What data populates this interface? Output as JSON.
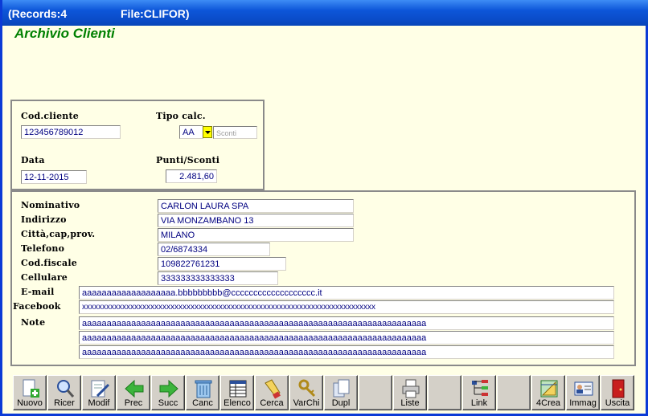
{
  "titlebar": {
    "records": "(Records:4",
    "file": "File:CLIFOR)"
  },
  "app_title": "Archivio Clienti",
  "top_panel": {
    "cod_cliente_label": "Cod.cliente",
    "cod_cliente_value": "123456789012",
    "tipo_calc_label": "Tipo calc.",
    "tipo_calc_value": "AA",
    "sconti_placeholder": "Sconti",
    "data_label": "Data",
    "data_value": "12-11-2015",
    "punti_label": "Punti/Sconti",
    "punti_value": "2.481,60"
  },
  "main_panel": {
    "nominativo_label": "Nominativo",
    "nominativo_value": "CARLON LAURA SPA",
    "indirizzo_label": "Indirizzo",
    "indirizzo_value": "VIA MONZAMBANO 13",
    "citta_label": "Città,cap,prov.",
    "citta_value": "MILANO",
    "telefono_label": "Telefono",
    "telefono_value": "02/6874334",
    "codfiscale_label": "Cod.fiscale",
    "codfiscale_value": "109822761231",
    "cellulare_label": "Cellulare",
    "cellulare_value": "333333333333333",
    "email_label": "E-mail",
    "email_value": "aaaaaaaaaaaaaaaaaaa.bbbbbbbbb@ccccccccccccccccccc.it",
    "facebook_label": "Facebook",
    "facebook_value": "xxxxxxxxxxxxxxxxxxxxxxxxxxxxxxxxxxxxxxxxxxxxxxxxxxxxxxxxxxxxxxxxxxxxxxxxx",
    "note_label": "Note",
    "note_lines": [
      "aaaaaaaaaaaaaaaaaaaaaaaaaaaaaaaaaaaaaaaaaaaaaaaaaaaaaaaaaaaaaaaaaaaaaa",
      "aaaaaaaaaaaaaaaaaaaaaaaaaaaaaaaaaaaaaaaaaaaaaaaaaaaaaaaaaaaaaaaaaaaaaa",
      "aaaaaaaaaaaaaaaaaaaaaaaaaaaaaaaaaaaaaaaaaaaaaaaaaaaaaaaaaaaaaaaaaaaaaa"
    ]
  },
  "toolbar": {
    "nuovo": "Nuovo",
    "ricer": "Ricer",
    "modif": "Modif",
    "prec": "Prec",
    "succ": "Succ",
    "canc": "Canc",
    "elenco": "Elenco",
    "cerca": "Cerca",
    "varchi": "VarChi",
    "dupl": "Dupl",
    "liste": "Liste",
    "link": "Link",
    "crea4": "4Crea",
    "immag": "Immag",
    "uscita": "Uscita"
  },
  "colors": {
    "title_green": "#008000",
    "field_text": "#000080",
    "background": "#ffffe6",
    "titlebar_blue": "#0a4bc7"
  }
}
